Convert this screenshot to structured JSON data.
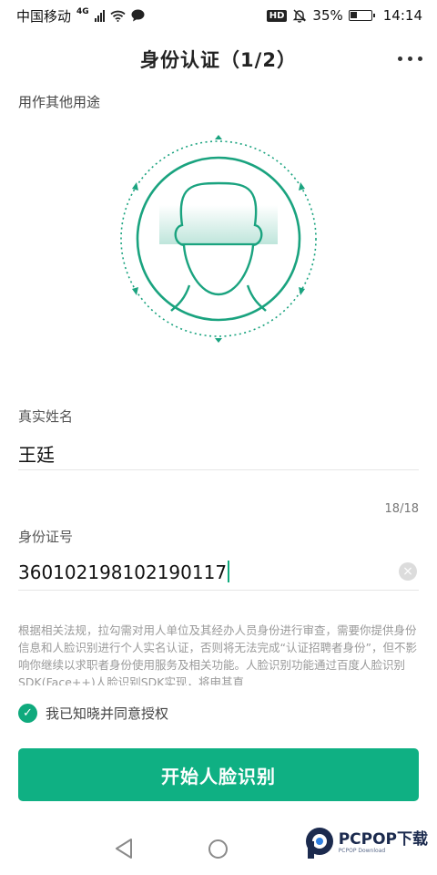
{
  "status_bar": {
    "carrier": "中国移动",
    "network": "4G",
    "battery": "35%",
    "battery_level": 0.35,
    "time": "14:14",
    "hd": "HD"
  },
  "header": {
    "title": "身份认证（1/2）"
  },
  "purpose": "用作其他用途",
  "form": {
    "name_label": "真实姓名",
    "name_value": "王廷",
    "counter": "18/18",
    "id_label": "身份证号",
    "id_value": "360102198102190117"
  },
  "legal_text": "根据相关法规，拉勾需对用人单位及其经办人员身份进行审查，需要你提供身份信息和人脸识别进行个人实名认证，否则将无法完成“认证招聘者身份”，但不影响你继续以求职者身份使用服务及相关功能。人脸识别功能通过百度人脸识别SDK(Face++)人脸识别SDK实现，将申其直",
  "consent_label": "我已知晓并同意授权",
  "start_button": "开始人脸识别",
  "watermark": {
    "brand": "PCPOP下载",
    "sub": "PCPOP Download"
  },
  "colors": {
    "accent": "#0fb083",
    "face_line": "#1aa37f"
  }
}
